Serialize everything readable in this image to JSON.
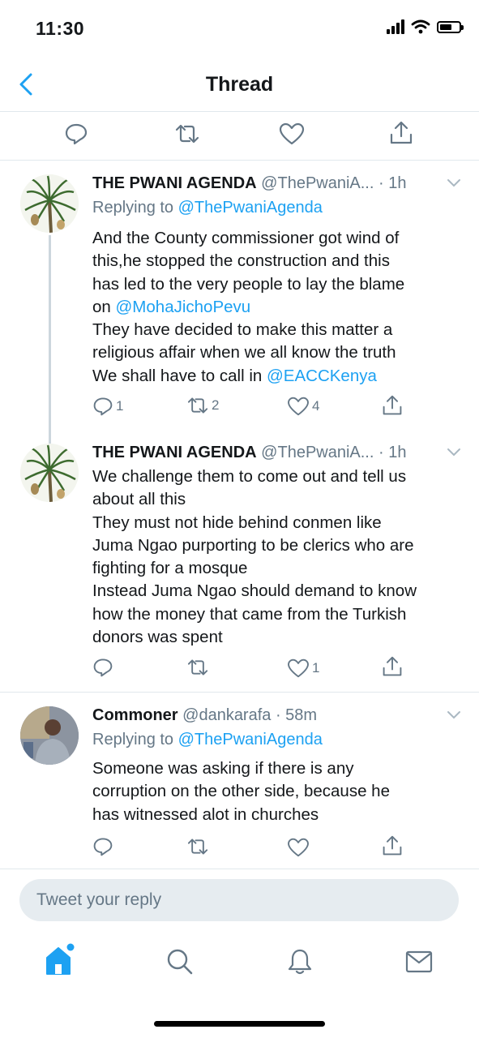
{
  "status_bar": {
    "time": "11:30"
  },
  "header": {
    "title": "Thread",
    "back_icon": "chevron-left-icon"
  },
  "top_actions": {
    "icons": [
      "reply-icon",
      "retweet-icon",
      "like-icon",
      "share-icon"
    ]
  },
  "tweets": [
    {
      "name": "THE PWANI AGENDA",
      "handle": "@ThePwaniA...",
      "time": "· 1h",
      "replying_prefix": "Replying to ",
      "replying_to": "@ThePwaniAgenda",
      "text_lines": [
        {
          "pre": "And the County commissioner got wind of",
          "mention": "",
          "post": ""
        },
        {
          "pre": "this,he stopped the construction and this",
          "mention": "",
          "post": ""
        },
        {
          "pre": "has led to the very people to lay the blame",
          "mention": "",
          "post": ""
        },
        {
          "pre": "on ",
          "mention": "@MohaJichoPevu",
          "post": ""
        },
        {
          "pre": "They have decided to make this matter a",
          "mention": "",
          "post": ""
        },
        {
          "pre": "religious affair when we all know the truth",
          "mention": "",
          "post": ""
        },
        {
          "pre": "We shall have to call in ",
          "mention": "@EACCKenya",
          "post": ""
        }
      ],
      "replies": "1",
      "retweets": "2",
      "likes": "4"
    },
    {
      "name": "THE PWANI AGENDA",
      "handle": "@ThePwaniA...",
      "time": "· 1h",
      "text_lines": [
        "We challenge them to come out and tell us",
        "about all this",
        "They must not hide behind conmen like",
        "Juma Ngao purporting to be clerics who are",
        "fighting for a mosque",
        "Instead Juma Ngao should demand to know",
        "how the money that came from the Turkish",
        "donors was spent"
      ],
      "replies": "",
      "retweets": "",
      "likes": "1"
    },
    {
      "name": "Commoner",
      "handle": "@dankarafa",
      "time": "· 58m",
      "replying_prefix": "Replying to ",
      "replying_to": "@ThePwaniAgenda",
      "text_lines": [
        "Someone was asking if there is any",
        "corruption on the other side, because he",
        "has witnessed alot in churches"
      ],
      "replies": "",
      "retweets": "",
      "likes": ""
    }
  ],
  "reply_input": {
    "placeholder": "Tweet your reply"
  },
  "bottom_nav": {
    "items": [
      "home-icon",
      "search-icon",
      "notifications-icon",
      "messages-icon"
    ]
  },
  "colors": {
    "accent": "#1da1f2",
    "text": "#14171a",
    "muted": "#657786",
    "divider": "#e1e8ed"
  }
}
